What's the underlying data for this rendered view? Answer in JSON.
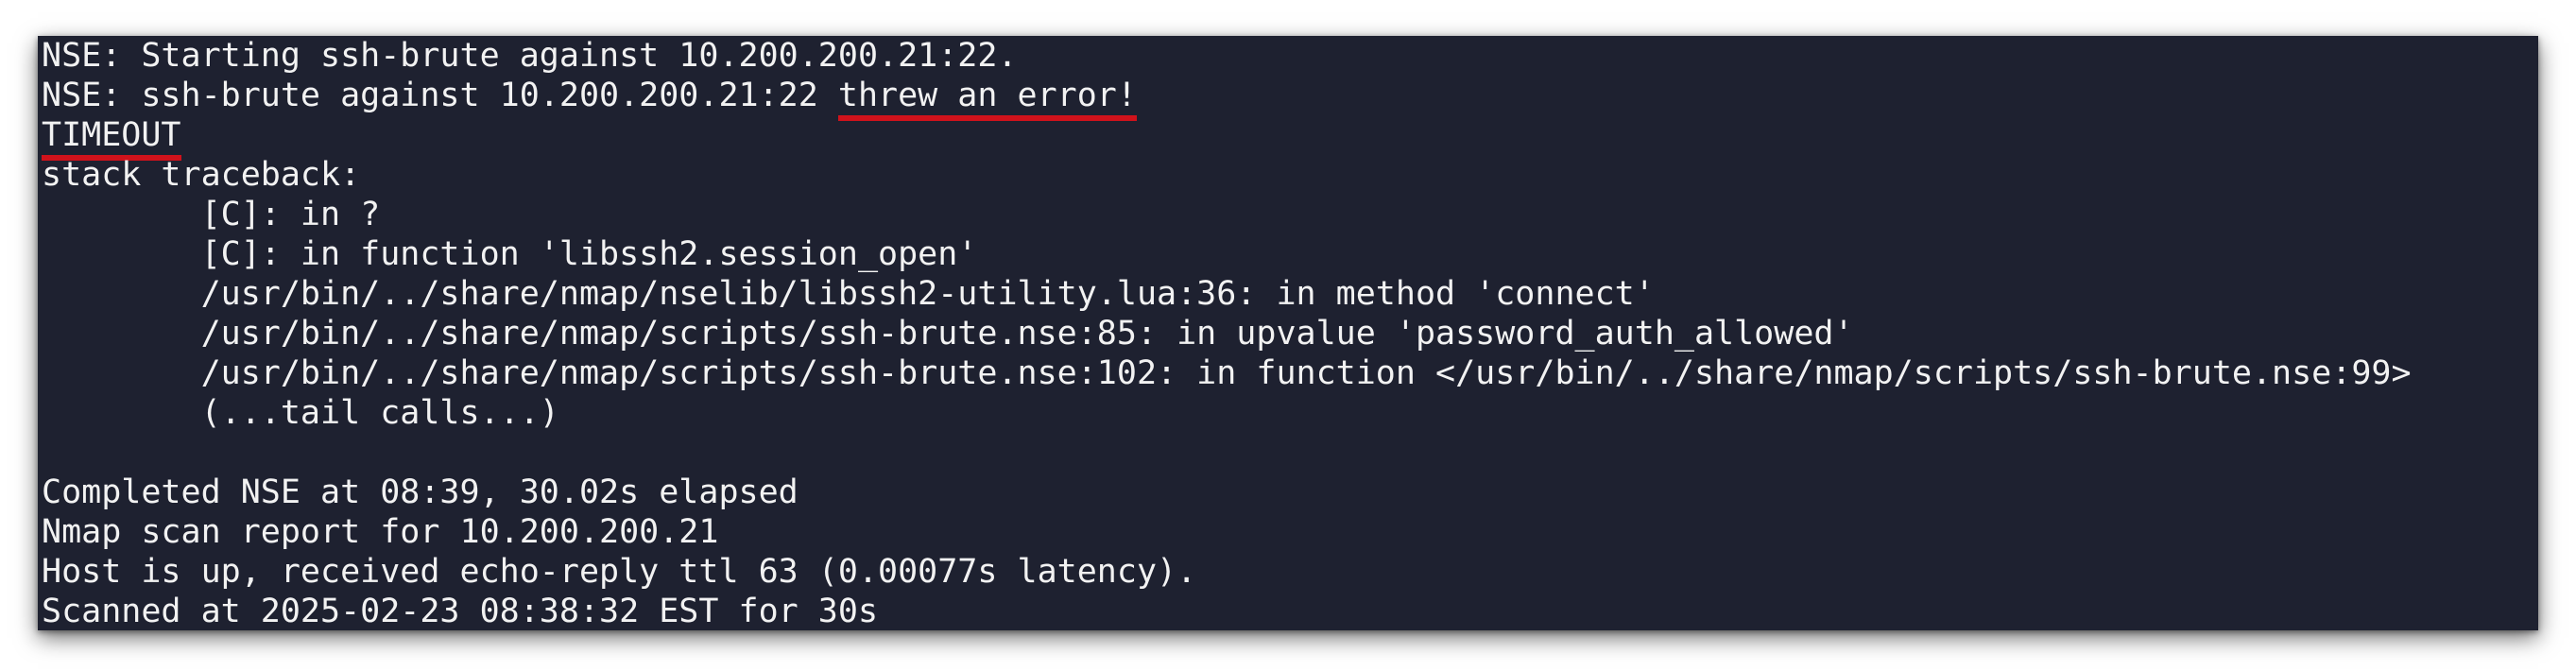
{
  "terminal": {
    "lines": [
      {
        "text": "NSE: Starting ssh-brute against 10.200.200.21:22."
      },
      {
        "prefix": "NSE: ssh-brute against 10.200.200.21:22 ",
        "highlight": "threw an error!"
      },
      {
        "highlight": "TIMEOUT"
      },
      {
        "text": "stack traceback:"
      },
      {
        "text": "        [C]: in ?"
      },
      {
        "text": "        [C]: in function 'libssh2.session_open'"
      },
      {
        "text": "        /usr/bin/../share/nmap/nselib/libssh2-utility.lua:36: in method 'connect'"
      },
      {
        "text": "        /usr/bin/../share/nmap/scripts/ssh-brute.nse:85: in upvalue 'password_auth_allowed'"
      },
      {
        "text": "        /usr/bin/../share/nmap/scripts/ssh-brute.nse:102: in function </usr/bin/../share/nmap/scripts/ssh-brute.nse:99>"
      },
      {
        "text": "        (...tail calls...)"
      },
      {
        "text": ""
      },
      {
        "text": "Completed NSE at 08:39, 30.02s elapsed"
      },
      {
        "text": "Nmap scan report for 10.200.200.21"
      },
      {
        "text": "Host is up, received echo-reply ttl 63 (0.00077s latency)."
      },
      {
        "text": "Scanned at 2025-02-23 08:38:32 EST for 30s"
      }
    ]
  },
  "colors": {
    "terminal_background": "#1e2130",
    "text": "#f2f2f2",
    "underline": "#d0121b"
  }
}
